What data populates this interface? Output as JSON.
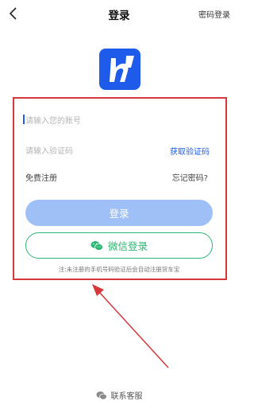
{
  "header": {
    "title": "登录",
    "password_login": "密码登录"
  },
  "form": {
    "account_placeholder": "请输入您的账号",
    "code_placeholder": "请输入验证码",
    "get_code": "获取验证码",
    "register": "免费注册",
    "forgot": "忘记密码?",
    "login_button": "登录",
    "wechat_button": "微信登录",
    "notice": "注:未注册的手机号码验证后会自动注册货车宝"
  },
  "footer": {
    "service": "联系客服"
  },
  "colors": {
    "brand": "#1f5bea",
    "login_disabled": "#9ec0f6",
    "wechat": "#2bb673",
    "annotation": "#d6373a"
  },
  "icons": [
    "chevron-left-icon",
    "app-logo-icon",
    "wechat-icon",
    "chat-bubbles-icon"
  ]
}
